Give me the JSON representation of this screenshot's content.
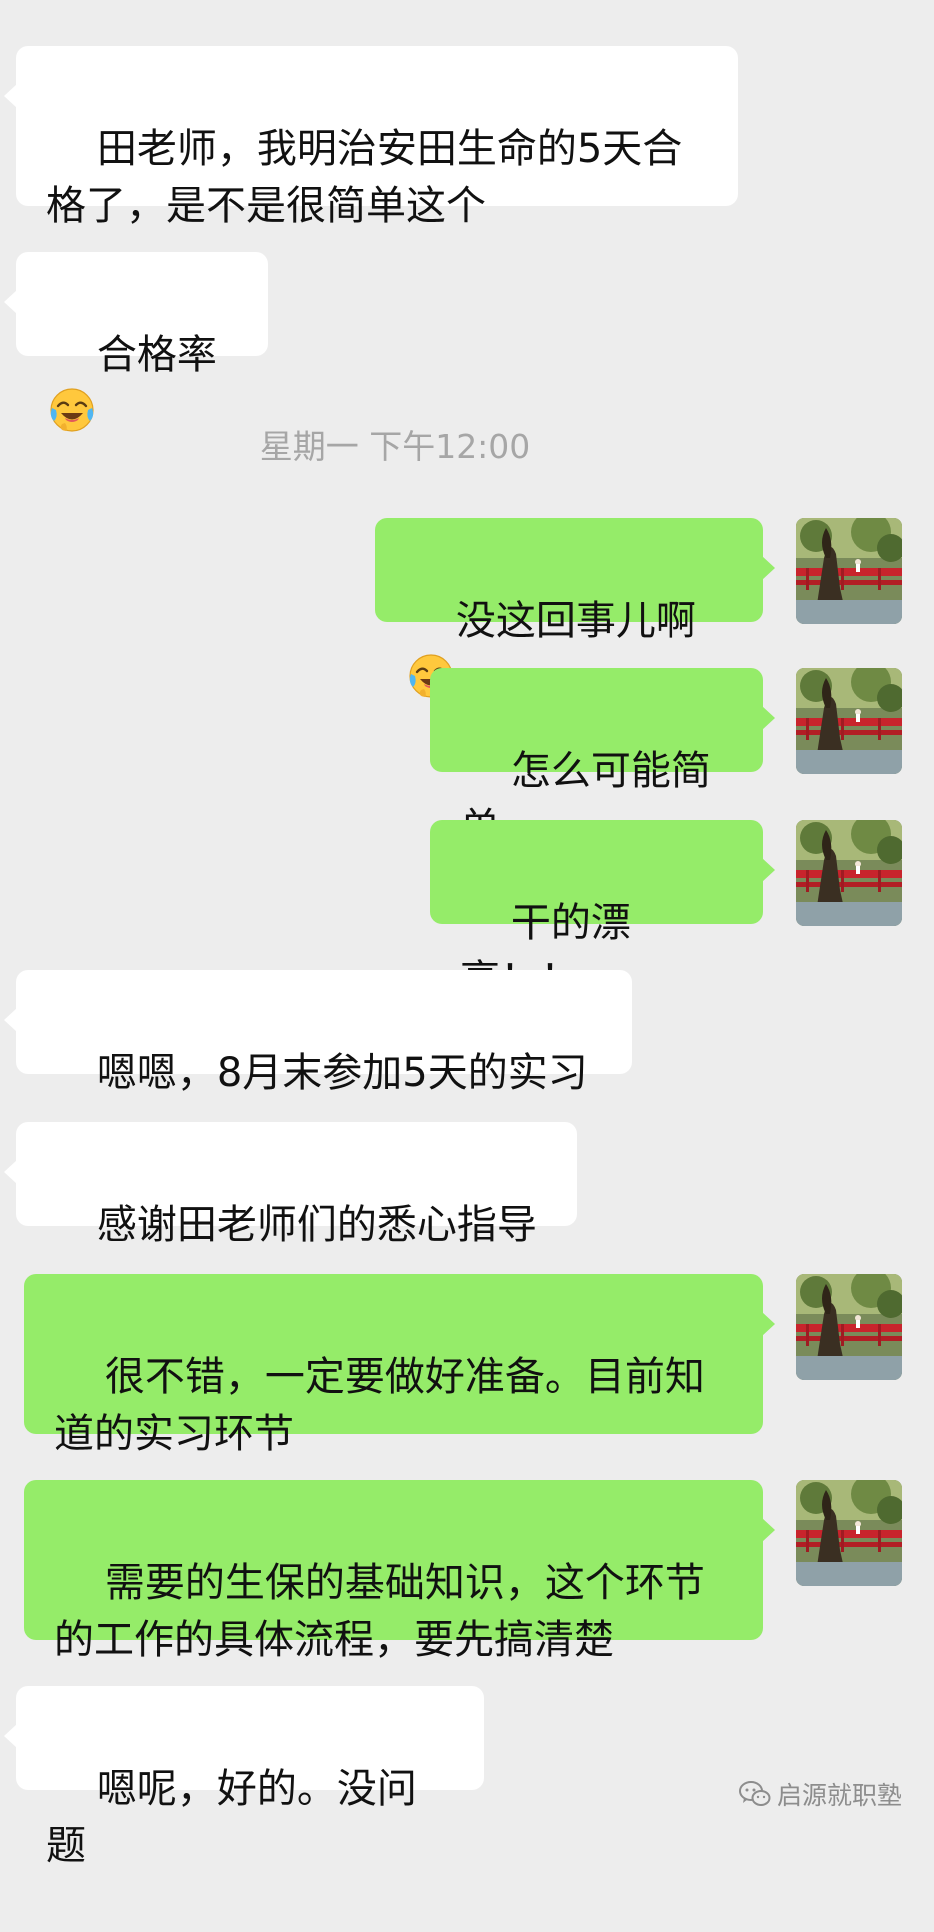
{
  "timestamp": "星期一 下午12:00",
  "messages": [
    {
      "text": "田老师，我明治安田生命的5天合\n格了，是不是很简单这个"
    },
    {
      "text": "合格率",
      "emoji": "laughing-crying-face-emoji"
    },
    {
      "text": "没这回事儿啊",
      "emoji": "laughing-crying-face-emoji"
    },
    {
      "text": "怎么可能简单"
    },
    {
      "text": "干的漂亮！！"
    },
    {
      "text": "嗯嗯，8月末参加5天的实习"
    },
    {
      "text": "感谢田老师们的悉心指导"
    },
    {
      "text": "很不错，一定要做好准备。目前知\n道的实习环节"
    },
    {
      "text": "需要的生保的基础知识，这个环节\n的工作的具体流程，要先搞清楚"
    },
    {
      "text": "嗯呢，好的。没问题"
    }
  ],
  "watermark": "启源就职塾",
  "colors": {
    "background": "#ededed",
    "incoming_bubble": "#ffffff",
    "outgoing_bubble": "#95ec69",
    "timestamp_text": "#a6a6a6"
  }
}
